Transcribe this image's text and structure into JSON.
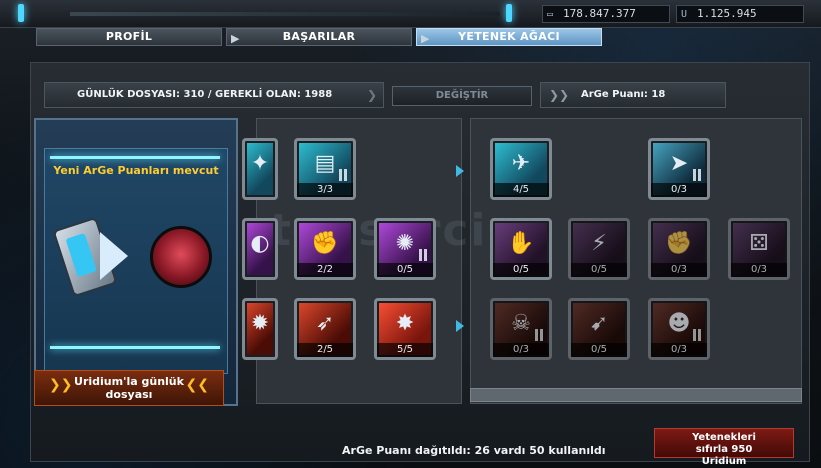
{
  "topbar": {
    "credits": "178.847.377",
    "uridium": "1.125.945",
    "credits_icon": "credits-icon",
    "uridium_icon": "uridium-icon"
  },
  "tabs": [
    {
      "label": "PROFİL",
      "active": false
    },
    {
      "label": "BAŞARILAR",
      "active": false
    },
    {
      "label": "YETENEK AĞACI",
      "active": true
    }
  ],
  "header": {
    "daily": "GÜNLÜK DOSYASI: 310 / GEREKLİ OLAN: 1988",
    "change_button": "DEĞİŞTİR",
    "arge_points": "ArGe Puanı: 18"
  },
  "card": {
    "title": "Yeni ArGe Puanları mevcut",
    "button": "Uridium'la günlük dosyası"
  },
  "tree": {
    "left": [
      {
        "name": "skill-cannon",
        "level": "",
        "color": "blue"
      },
      {
        "name": "skill-shield-plate",
        "level": "3/3",
        "color": "blue"
      },
      {
        "name": "skill-emp",
        "level": "",
        "color": "purple"
      },
      {
        "name": "skill-fist",
        "level": "2/2",
        "color": "purple"
      },
      {
        "name": "skill-blast",
        "level": "0/5",
        "color": "purple"
      },
      {
        "name": "skill-heat",
        "level": "",
        "color": "red"
      },
      {
        "name": "skill-rocket",
        "level": "2/5",
        "color": "red"
      },
      {
        "name": "skill-explosion",
        "level": "5/5",
        "color": "red"
      }
    ],
    "right": [
      {
        "name": "skill-ship-speed",
        "level": "4/5",
        "color": "blue"
      },
      {
        "name": "skill-ship-boost",
        "level": "0/3",
        "color": "blue"
      },
      {
        "name": "skill-hand",
        "level": "0/5",
        "color": "purple"
      },
      {
        "name": "skill-beam",
        "level": "0/5",
        "color": "purple"
      },
      {
        "name": "skill-power-fist",
        "level": "0/3",
        "color": "purple"
      },
      {
        "name": "skill-dice",
        "level": "0/3",
        "color": "purple"
      },
      {
        "name": "skill-skull",
        "level": "0/3",
        "color": "red"
      },
      {
        "name": "skill-missile",
        "level": "0/5",
        "color": "red"
      },
      {
        "name": "skill-alien",
        "level": "0/3",
        "color": "red"
      }
    ]
  },
  "footer": {
    "distributed": "ArGe Puanı dağıtıldı: 26 vardı 50 kullanıldı",
    "reset_button": "Yetenekleri sıfırla 950 Uridium"
  },
  "watermark": "tensorcis"
}
